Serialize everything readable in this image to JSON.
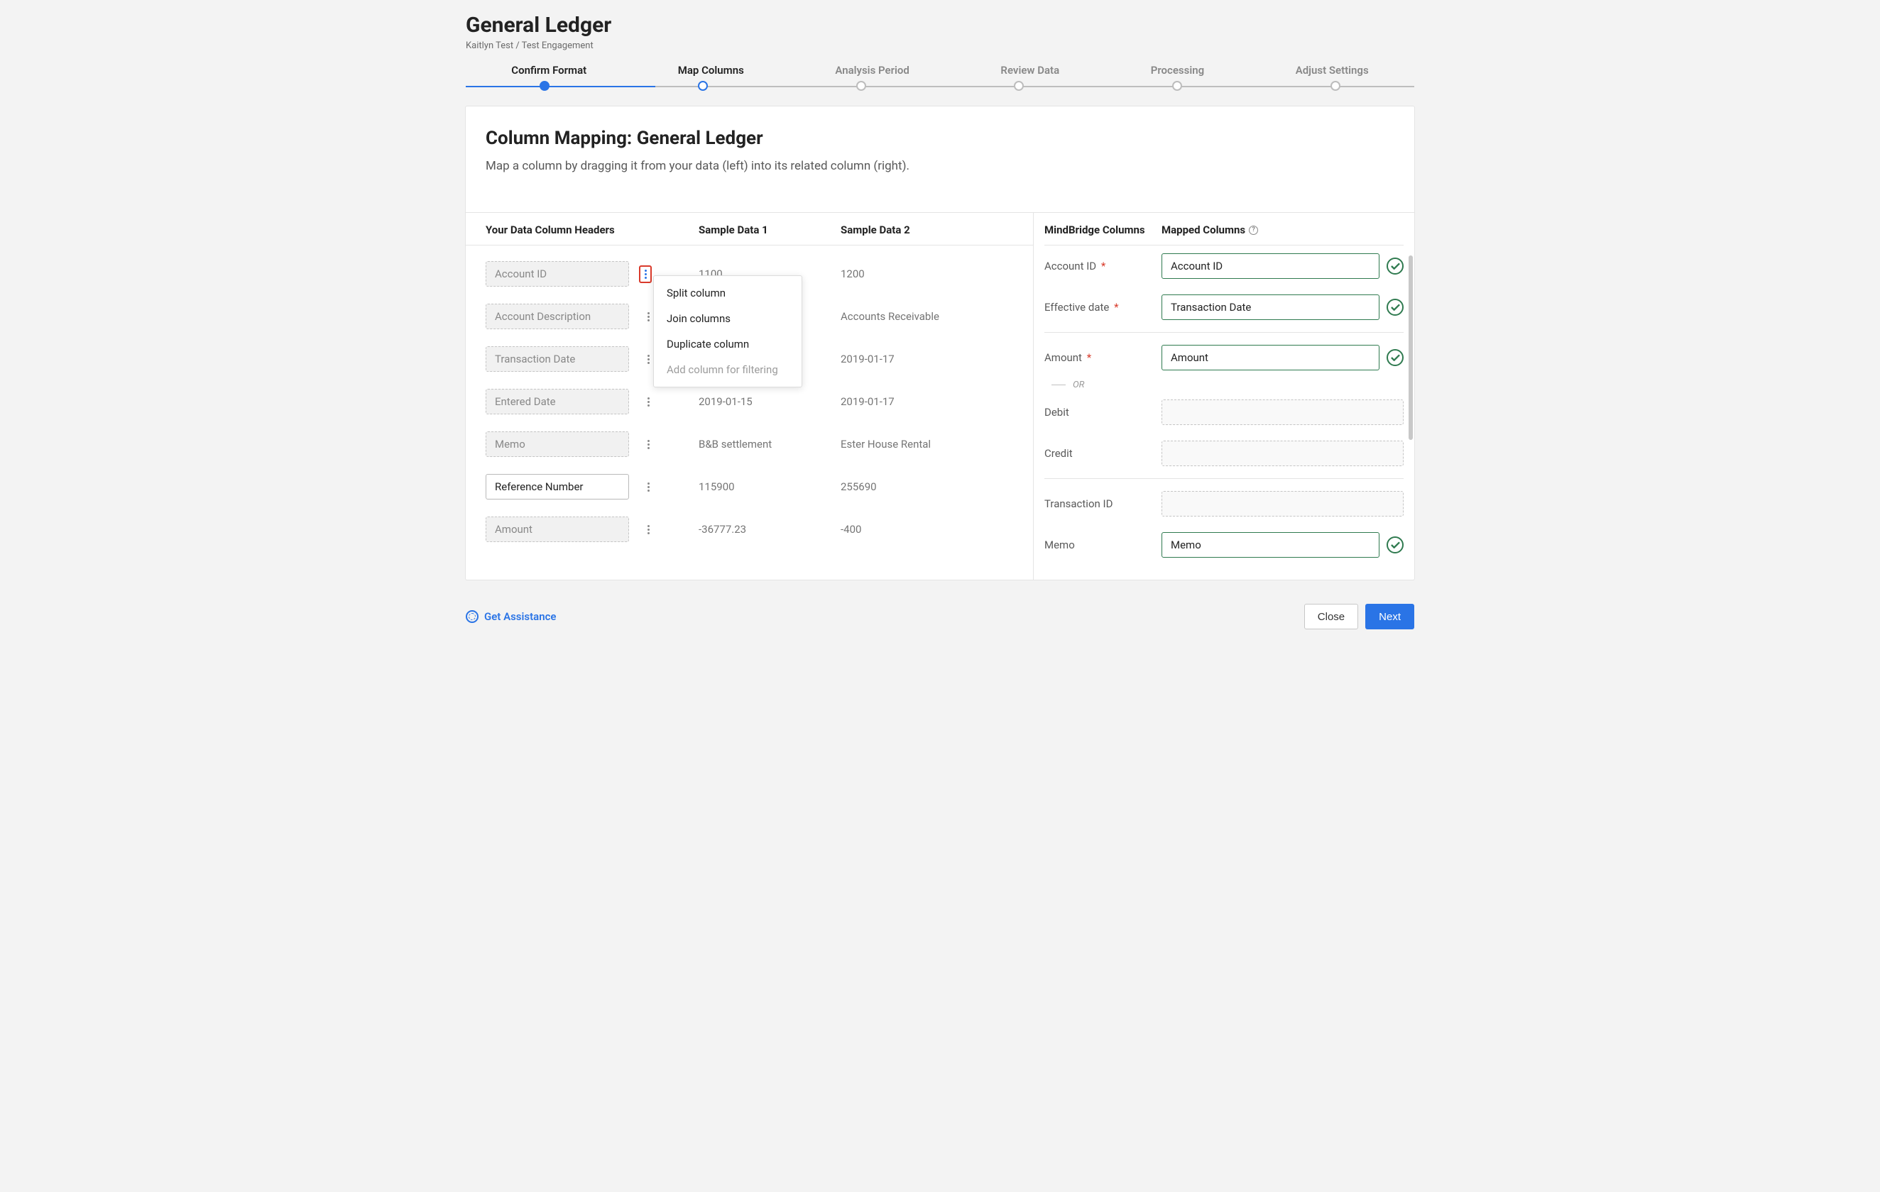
{
  "header": {
    "title": "General Ledger",
    "breadcrumb": "Kaitlyn Test / Test Engagement"
  },
  "stepper": {
    "steps": [
      {
        "label": "Confirm Format",
        "state": "done"
      },
      {
        "label": "Map Columns",
        "state": "current"
      },
      {
        "label": "Analysis Period",
        "state": "pending"
      },
      {
        "label": "Review Data",
        "state": "pending"
      },
      {
        "label": "Processing",
        "state": "pending"
      },
      {
        "label": "Adjust Settings",
        "state": "pending"
      }
    ]
  },
  "card": {
    "title": "Column Mapping: General Ledger",
    "subtitle": "Map a column by dragging it from your data (left) into its related column (right)."
  },
  "left": {
    "headers": {
      "col1": "Your Data Column Headers",
      "col2": "Sample Data 1",
      "col3": "Sample Data 2"
    },
    "rows": [
      {
        "name": "Account ID",
        "s1": "1100",
        "s2": "1200",
        "mapped": true,
        "highlighted": true
      },
      {
        "name": "Account Description",
        "s1": "",
        "s2": "Accounts Receivable",
        "mapped": true
      },
      {
        "name": "Transaction Date",
        "s1": "",
        "s2": "2019-01-17",
        "mapped": true
      },
      {
        "name": "Entered Date",
        "s1": "2019-01-15",
        "s2": "2019-01-17",
        "mapped": true
      },
      {
        "name": "Memo",
        "s1": "B&B settlement",
        "s2": "Ester House Rental",
        "mapped": true
      },
      {
        "name": "Reference Number",
        "s1": "115900",
        "s2": "255690",
        "mapped": false
      },
      {
        "name": "Amount",
        "s1": "-36777.23",
        "s2": "-400",
        "mapped": true
      }
    ],
    "menu": {
      "items": [
        {
          "label": "Split column",
          "enabled": true
        },
        {
          "label": "Join columns",
          "enabled": true
        },
        {
          "label": "Duplicate column",
          "enabled": true
        },
        {
          "label": "Add column for filtering",
          "enabled": false
        }
      ]
    }
  },
  "right": {
    "headers": {
      "col1": "MindBridge Columns",
      "col2": "Mapped Columns"
    },
    "rows": [
      {
        "label": "Account ID",
        "required": true,
        "value": "Account ID",
        "checked": true
      },
      {
        "label": "Effective date",
        "required": true,
        "value": "Transaction Date",
        "checked": true
      }
    ],
    "section2": [
      {
        "label": "Amount",
        "required": true,
        "value": "Amount",
        "checked": true
      }
    ],
    "or_label": "OR",
    "section3": [
      {
        "label": "Debit",
        "required": false,
        "value": "",
        "checked": false
      },
      {
        "label": "Credit",
        "required": false,
        "value": "",
        "checked": false
      }
    ],
    "section4": [
      {
        "label": "Transaction ID",
        "required": false,
        "value": "",
        "checked": false
      },
      {
        "label": "Memo",
        "required": false,
        "value": "Memo",
        "checked": true
      }
    ]
  },
  "footer": {
    "assist": "Get Assistance",
    "close": "Close",
    "next": "Next"
  }
}
